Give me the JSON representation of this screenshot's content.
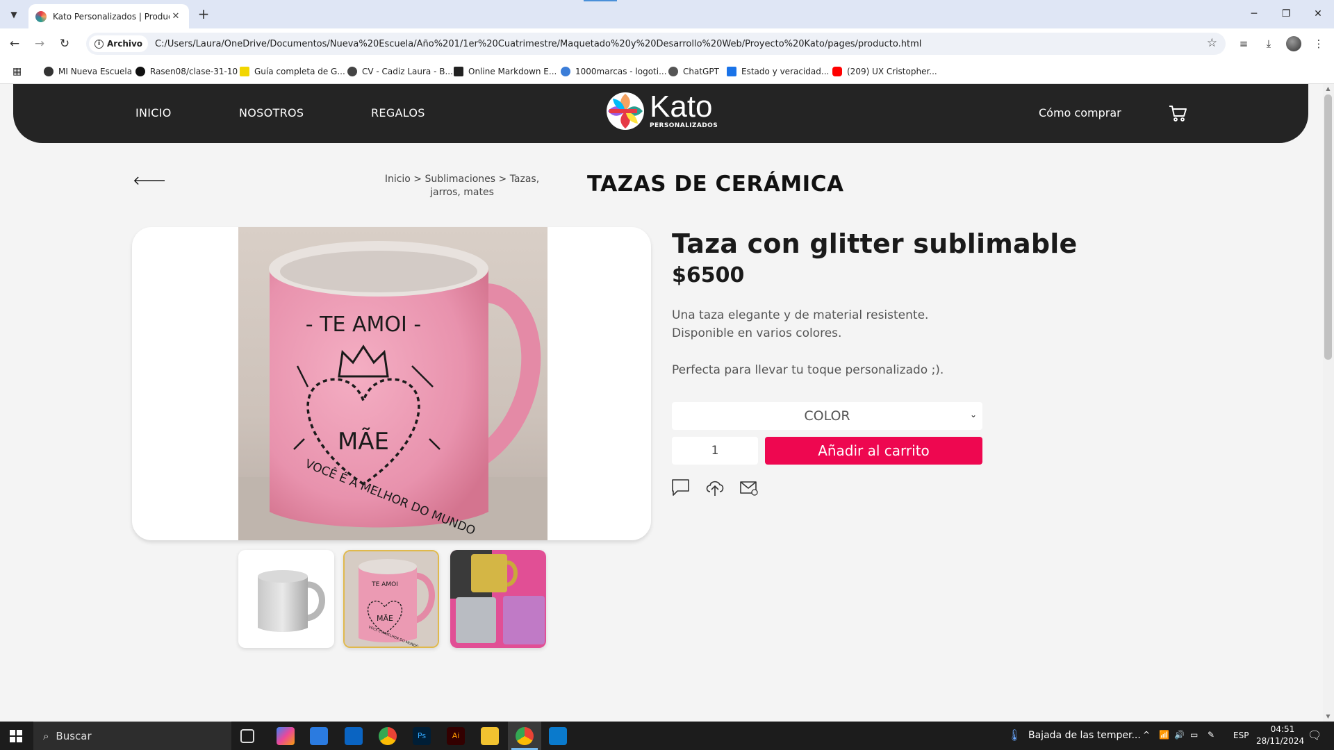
{
  "browser": {
    "tab_title": "Kato Personalizados | Producto",
    "omnibox_chip": "Archivo",
    "url": "C:/Users/Laura/OneDrive/Documentos/Nueva%20Escuela/Año%201/1er%20Cuatrimestre/Maquetado%20y%20Desarrollo%20Web/Proyecto%20Kato/pages/producto.html",
    "bookmarks": [
      {
        "label": "MI Nueva Escuela",
        "color": "#333333"
      },
      {
        "label": "Rasen08/clase-31-10",
        "color": "#111111"
      },
      {
        "label": "Guía completa de G...",
        "color": "#f2d600"
      },
      {
        "label": "CV - Cadiz Laura - B...",
        "color": "#444444"
      },
      {
        "label": "Online Markdown E...",
        "color": "#222222"
      },
      {
        "label": "1000marcas - logoti...",
        "color": "#3b7dd8"
      },
      {
        "label": "ChatGPT",
        "color": "#555555"
      },
      {
        "label": "Estado y veracidad...",
        "color": "#1a73e8"
      },
      {
        "label": "(209) UX Cristopher...",
        "color": "#ff0000"
      }
    ]
  },
  "header": {
    "nav": [
      "INICIO",
      "NOSOTROS",
      "REGALOS"
    ],
    "logo_name": "Kato",
    "logo_sub": "PERSONALIZADOS",
    "how_to_buy": "Cómo comprar"
  },
  "page": {
    "breadcrumb": "Inicio > Sublimaciones > Tazas, jarros, mates",
    "category_title": "TAZAS DE CERÁMICA",
    "mug_text_top": "- TE AMOI -",
    "mug_text_center": "MÃE",
    "mug_text_bottom": "VOCÊ É A MELHOR DO MUNDO",
    "thumb_text_top": "TE AMOI",
    "thumb_text_center": "MÃE",
    "thumb_text_bottom": "VOCÊ É A MELHOR DO MUNDO"
  },
  "product": {
    "name": "Taza con glitter sublimable",
    "price": "$6500",
    "desc_line1": "Una taza elegante y de material resistente.",
    "desc_line2": "Disponible en varios colores.",
    "desc_line3": "Perfecta para llevar tu toque personalizado ;).",
    "color_select": "COLOR",
    "quantity": "1",
    "add_to_cart": "Añadir al carrito",
    "accent_color": "#ee0750"
  },
  "taskbar": {
    "search_placeholder": "Buscar",
    "weather": "Bajada de las temper...",
    "lang": "ESP",
    "time": "04:51",
    "date": "28/11/2024"
  }
}
